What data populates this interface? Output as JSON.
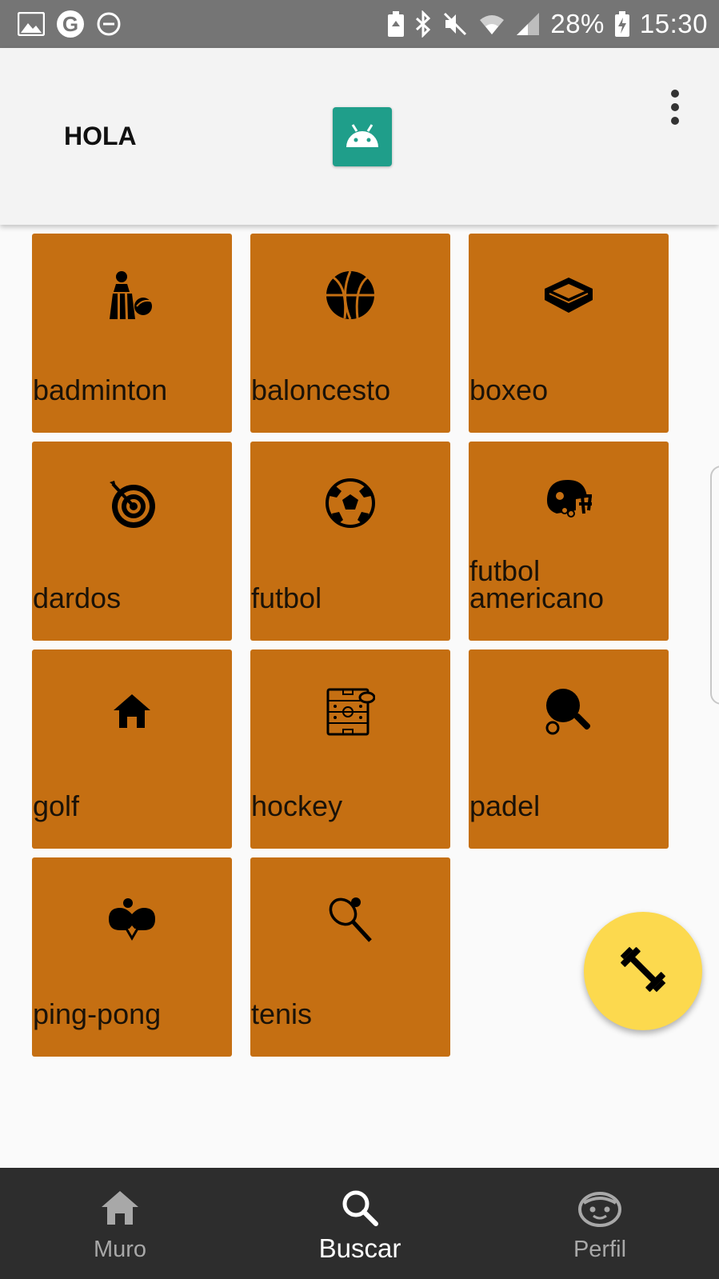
{
  "status_bar": {
    "battery": "28%",
    "time": "15:30",
    "left_icons": [
      "image-icon",
      "google-icon",
      "do-not-disturb-icon"
    ],
    "right_icons": [
      "battery-saver-icon",
      "bluetooth-icon",
      "mute-icon",
      "wifi-icon",
      "signal-icon",
      "battery-charging-icon"
    ]
  },
  "app_bar": {
    "title": "HOLA",
    "logo_icon": "android-icon",
    "menu_icon": "more-vert-icon"
  },
  "sports": [
    {
      "label": "badminton",
      "icon": "shuttlecock-icon"
    },
    {
      "label": "baloncesto",
      "icon": "basketball-icon"
    },
    {
      "label": "boxeo",
      "icon": "boxing-ring-icon"
    },
    {
      "label": "dardos",
      "icon": "dartboard-icon"
    },
    {
      "label": "futbol",
      "icon": "soccer-ball-icon"
    },
    {
      "label": "futbol americano",
      "icon": "football-helmet-icon"
    },
    {
      "label": "golf",
      "icon": "home-icon"
    },
    {
      "label": "hockey",
      "icon": "hockey-rink-icon"
    },
    {
      "label": "padel",
      "icon": "padel-racket-icon"
    },
    {
      "label": "ping-pong",
      "icon": "ping-pong-icon"
    },
    {
      "label": "tenis",
      "icon": "tennis-racket-icon"
    }
  ],
  "fab": {
    "icon": "dumbbell-icon"
  },
  "bottom_nav": {
    "items": [
      {
        "label": "Muro",
        "icon": "home-icon"
      },
      {
        "label": "Buscar",
        "icon": "search-icon",
        "active": true
      },
      {
        "label": "Perfil",
        "icon": "face-icon"
      }
    ]
  },
  "colors": {
    "tile": "#c56f12",
    "fab": "#fcd94e",
    "nav_bg": "#2d2d2d",
    "status_bg": "#757575",
    "app_bar_bg": "#f3f3f3",
    "logo": "#1f9e8a"
  }
}
